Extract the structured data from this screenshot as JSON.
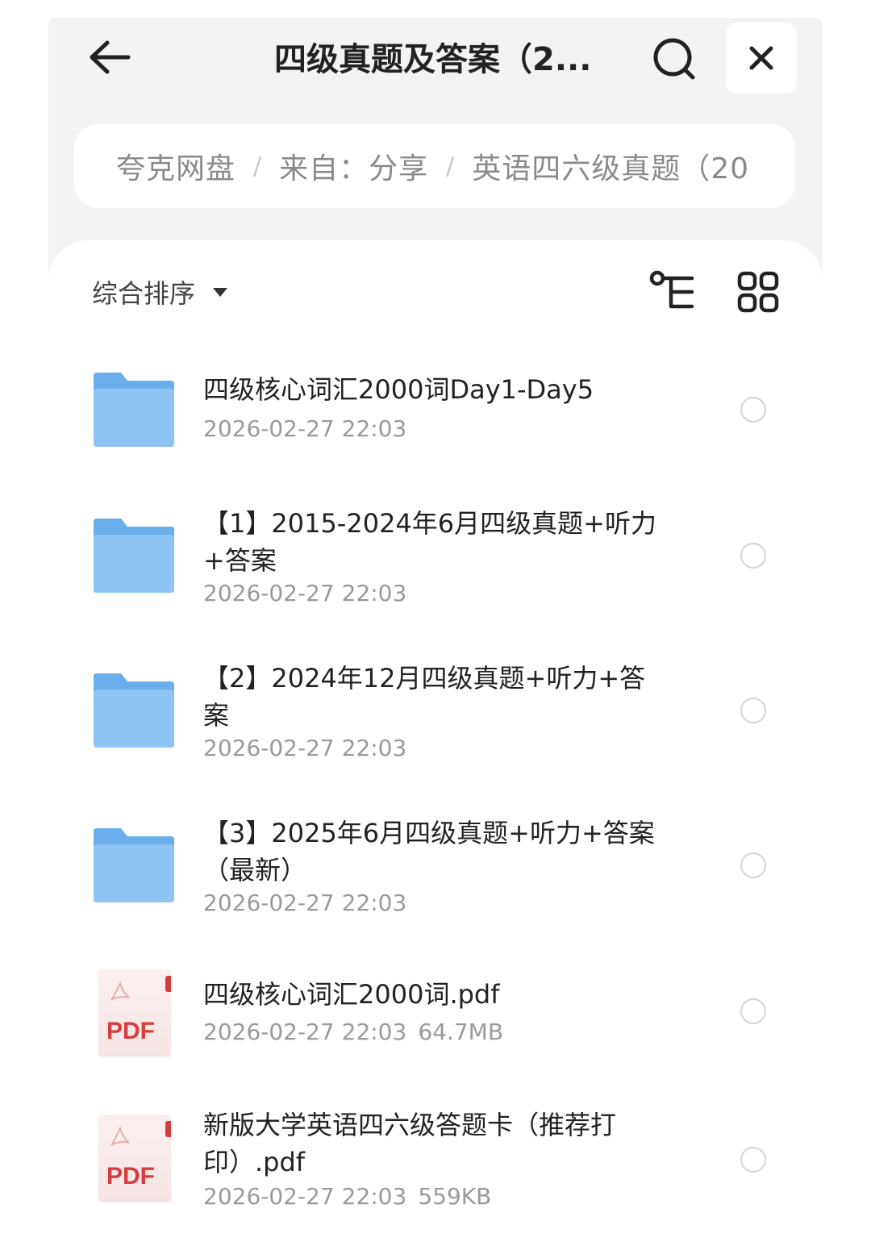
{
  "header": {
    "title": "四级真题及答案（2...",
    "back_icon": "arrow-left-icon",
    "search_icon": "search-icon",
    "close_icon": "close-icon"
  },
  "breadcrumb": {
    "items": [
      "夸克网盘",
      "来自：分享",
      "英语四六级真题（20"
    ],
    "separator": "/"
  },
  "toolbar": {
    "sort_label": "综合排序",
    "tree_icon": "tree-view-icon",
    "grid_icon": "grid-view-icon"
  },
  "files": [
    {
      "type": "folder",
      "name": "四级核心词汇2000词Day1-Day5",
      "date": "2026-02-27 22:03",
      "size": ""
    },
    {
      "type": "folder",
      "name": "【1】2015-2024年6月四级真题+听力+答案",
      "date": "2026-02-27 22:03",
      "size": ""
    },
    {
      "type": "folder",
      "name": "【2】2024年12月四级真题+听力+答案",
      "date": "2026-02-27 22:03",
      "size": ""
    },
    {
      "type": "folder",
      "name": "【3】2025年6月四级真题+听力+答案（最新）",
      "date": "2026-02-27 22:03",
      "size": ""
    },
    {
      "type": "pdf",
      "name": "四级核心词汇2000词.pdf",
      "date": "2026-02-27 22:03",
      "size": "64.7MB"
    },
    {
      "type": "pdf",
      "name": "新版大学英语四六级答题卡（推荐打印）.pdf",
      "date": "2026-02-27 22:03",
      "size": "559KB"
    }
  ],
  "pdf_badge": "PDF",
  "colors": {
    "folder": "#7db8f0",
    "pdf_red": "#d93c3c",
    "title": "#222222",
    "meta": "#9a9a9a"
  }
}
